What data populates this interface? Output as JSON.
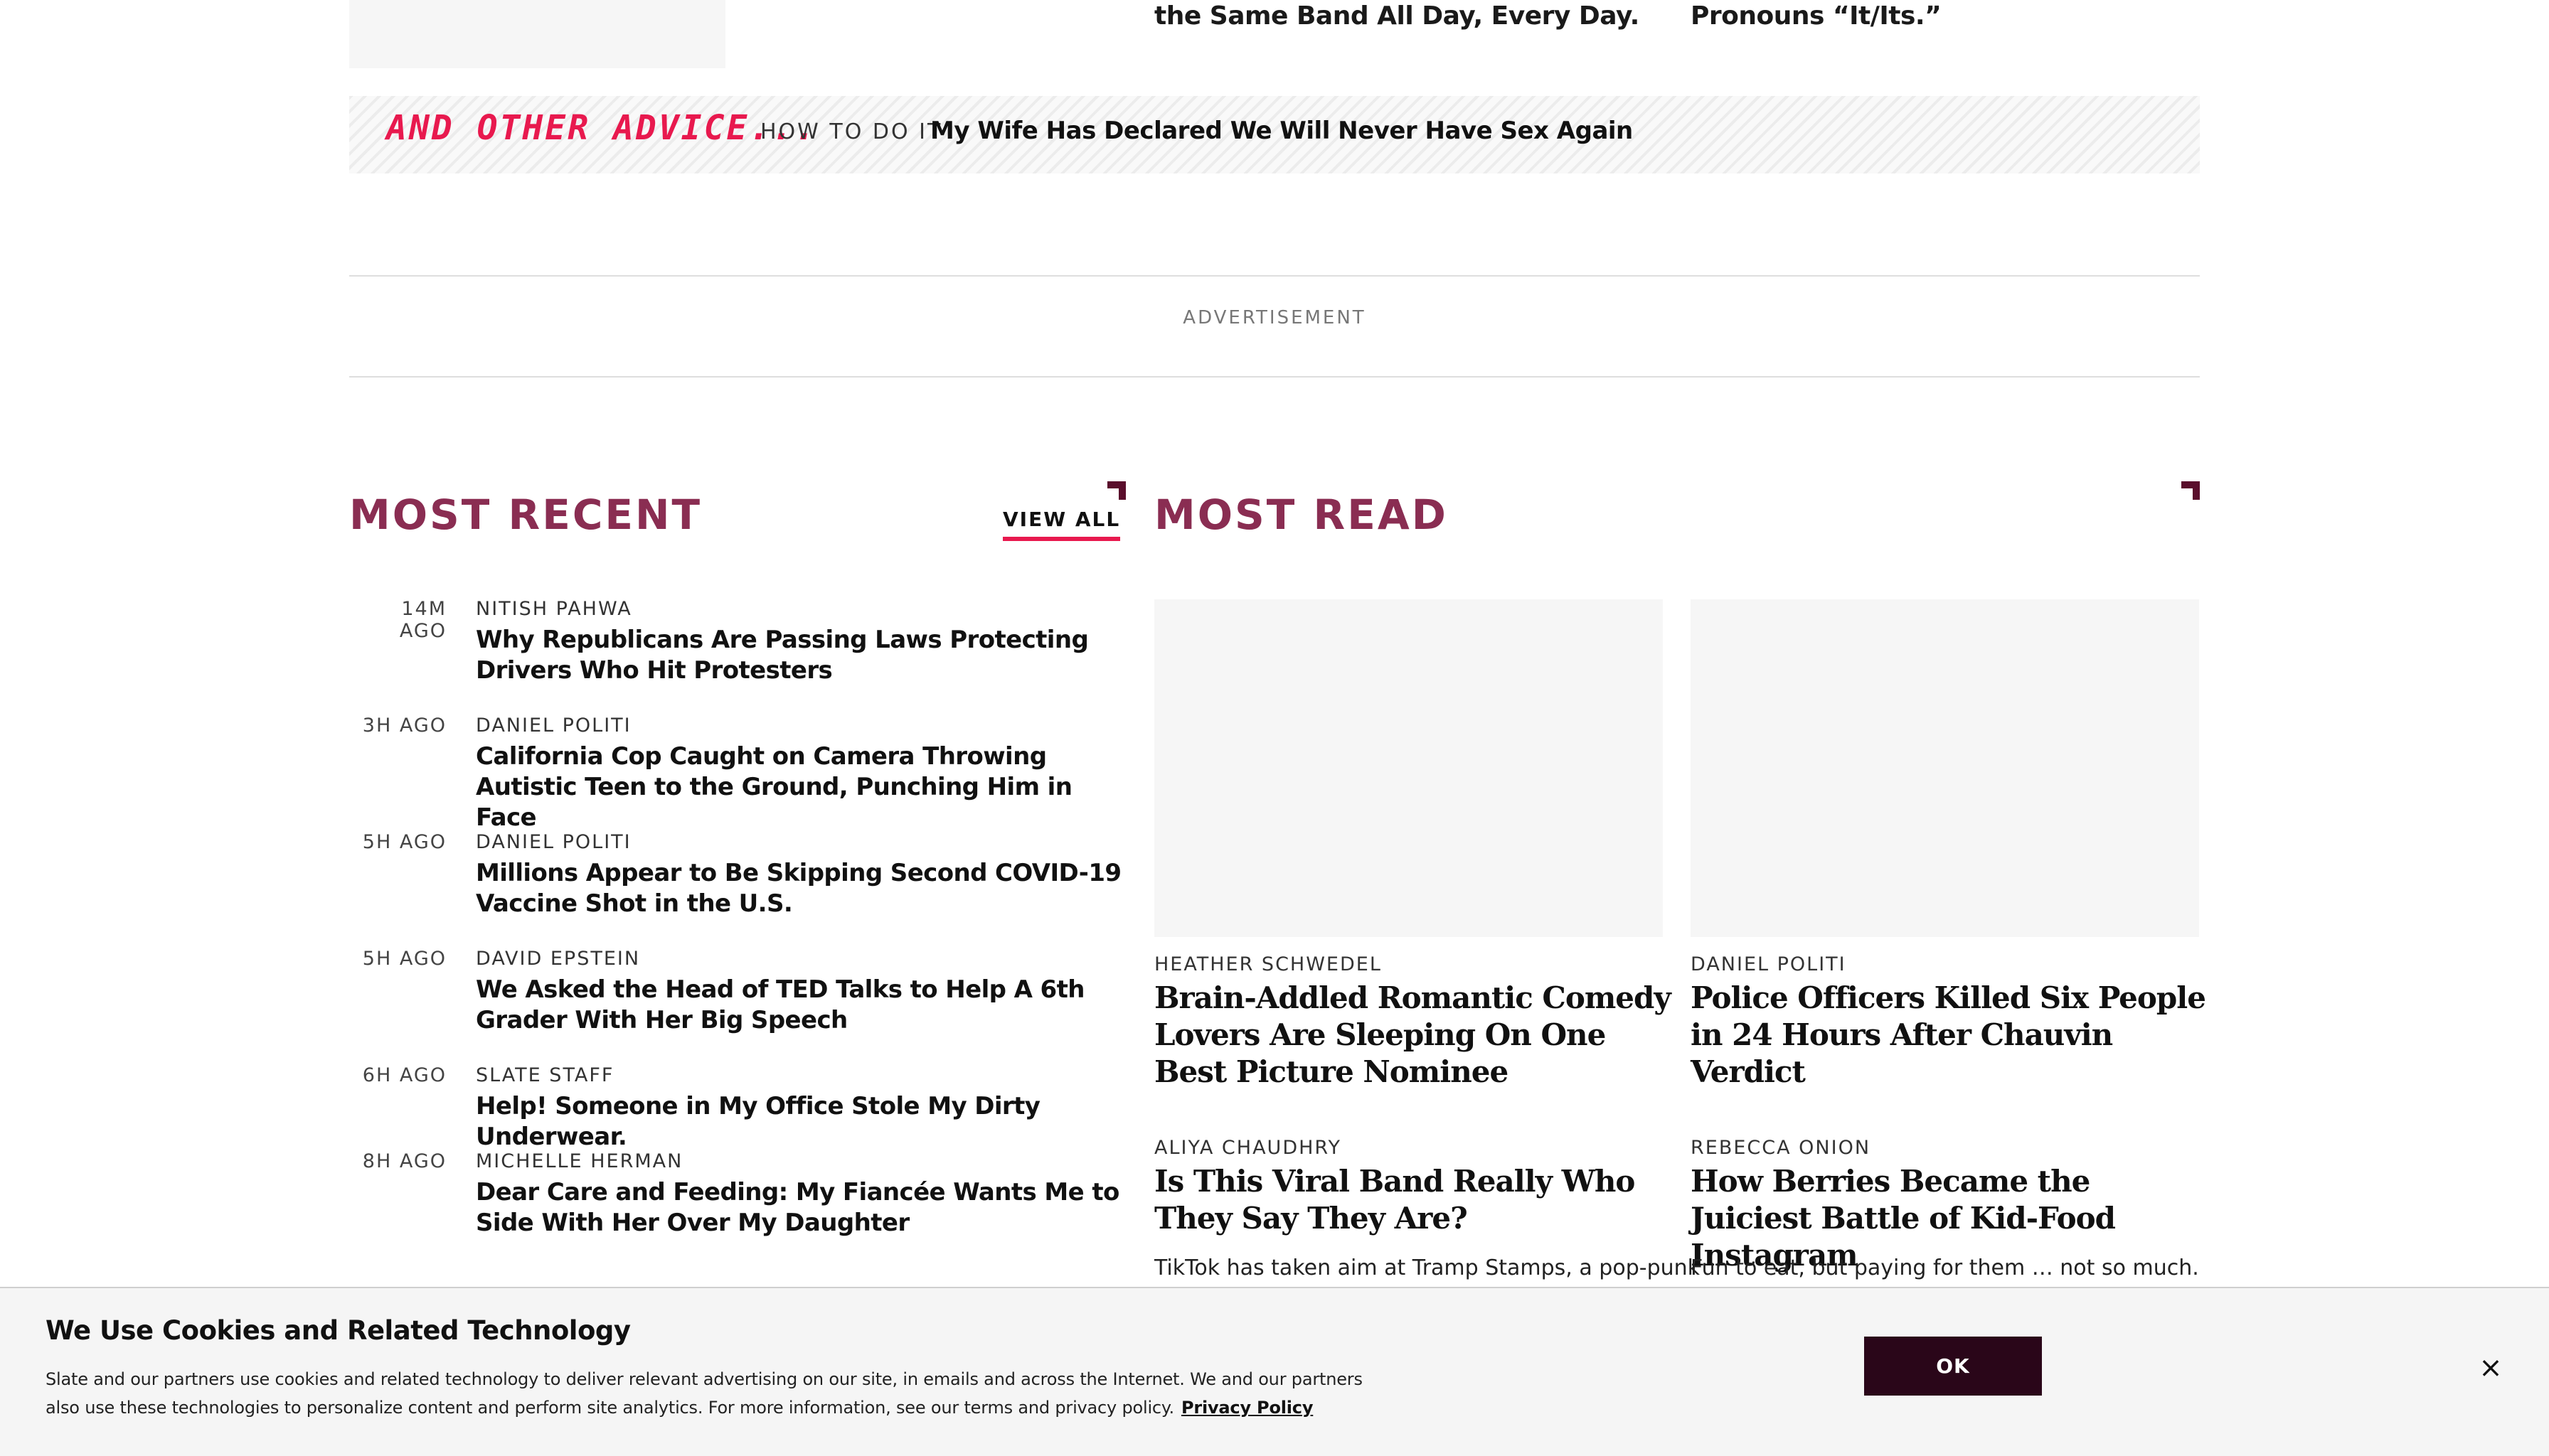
{
  "top_row": {
    "headline_left_tail": "the Same Band All Day, Every Day.",
    "headline_right_tail": "Pronouns “It/Its.”"
  },
  "advice": {
    "title": "AND OTHER ADVICE...",
    "kicker": "HOW TO DO IT",
    "link": "My Wife Has Declared We Will Never Have Sex Again",
    "title_color": "#e8194e"
  },
  "advertisement": {
    "label": "ADVERTISEMENT"
  },
  "most_recent": {
    "title": "MOST RECENT",
    "view_all": "VIEW ALL",
    "items": [
      {
        "time": "14M AGO",
        "author": "NITISH PAHWA",
        "title": "Why Republicans Are Passing Laws Protecting Drivers Who Hit Protesters"
      },
      {
        "time": "3H AGO",
        "author": "DANIEL POLITI",
        "title": "California Cop Caught on Camera Throwing Autistic Teen to the Ground, Punching Him in Face"
      },
      {
        "time": "5H AGO",
        "author": "DANIEL POLITI",
        "title": "Millions Appear to Be Skipping Second COVID-19 Vaccine Shot in the U.S."
      },
      {
        "time": "5H AGO",
        "author": "DAVID EPSTEIN",
        "title": "We Asked the Head of TED Talks to Help A 6th Grader With Her Big Speech"
      },
      {
        "time": "6H AGO",
        "author": "SLATE STAFF",
        "title": "Help! Someone in My Office Stole My Dirty Underwear."
      },
      {
        "time": "8H AGO",
        "author": "MICHELLE HERMAN",
        "title": "Dear Care and Feeding: My Fiancée Wants Me to Side With Her Over My Daughter"
      }
    ]
  },
  "most_read": {
    "title": "MOST READ",
    "cards": [
      {
        "author": "HEATHER SCHWEDEL",
        "title": "Brain-Addled Romantic Comedy Lovers Are Sleeping On One Best Picture Nominee"
      },
      {
        "author": "DANIEL POLITI",
        "title": "Police Officers Killed Six People in 24 Hours After Chauvin Verdict"
      },
      {
        "author": "ALIYA CHAUDHRY",
        "title": "Is This Viral Band Really Who They Say They Are?",
        "dek": "TikTok has taken aim at Tramp Stamps, a pop-punk"
      },
      {
        "author": "REBECCA ONION",
        "title": "How Berries Became the Juiciest Battle of Kid-Food Instagram",
        "dek": "Fun to eat, but paying for them … not so much."
      }
    ]
  },
  "cookie_banner": {
    "title": "We Use Cookies and Related Technology",
    "text": "Slate and our partners use cookies and related technology to deliver relevant advertising on our site, in emails and across the Internet. We and our partners also use these technologies to personalize content and perform site analytics. For more information, see our terms and privacy policy.",
    "privacy_link": "Privacy Policy",
    "ok_label": "OK",
    "close_icon": "×"
  },
  "colors": {
    "section_title": "#8a2d52",
    "accent": "#e8194e",
    "button_bg": "#2a0619"
  }
}
